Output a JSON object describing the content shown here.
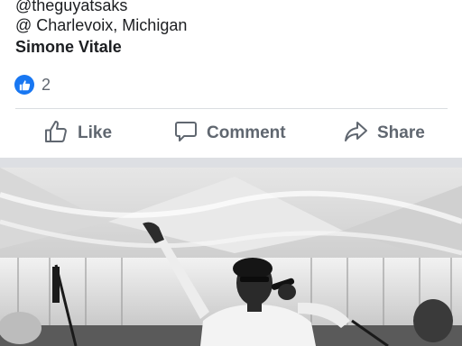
{
  "post": {
    "caption_handle": "@theguyatsaks",
    "caption_location": "@ Charlevoix, Michigan",
    "caption_author": "Simone Vitale",
    "reactions_count": "2"
  },
  "actions": {
    "like_label": "Like",
    "comment_label": "Comment",
    "share_label": "Share"
  },
  "icons": {
    "reaction": "thumbs-up-icon",
    "like": "thumbs-up-outline-icon",
    "comment": "speech-bubble-icon",
    "share": "share-arrow-icon"
  },
  "colors": {
    "brand_blue": "#1877f2",
    "action_text": "#606770",
    "body_text": "#1c1e21",
    "divider": "#dadde1",
    "feed_gap": "#dddfe3"
  },
  "photo": {
    "description_style": "black-and-white"
  }
}
